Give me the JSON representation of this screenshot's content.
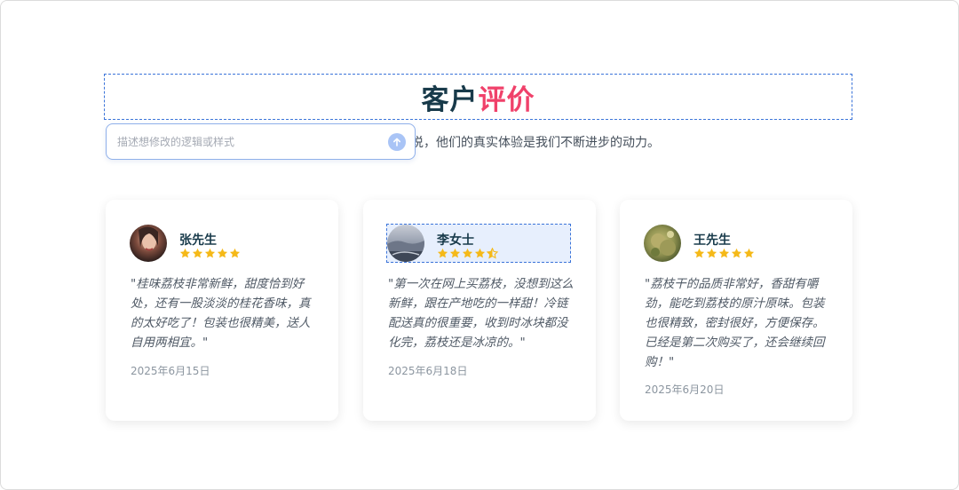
{
  "section": {
    "title_part1": "客户",
    "title_part2": "评价",
    "subtitle_left": "",
    "subtitle_right": "说，他们的真实体验是我们不断进步的动力。"
  },
  "ai_input": {
    "placeholder": "描述想修改的逻辑或样式"
  },
  "colors": {
    "accent": "#f0416a",
    "heading": "#183a4a",
    "star": "#f5b918",
    "selection": "#3b74d9"
  },
  "reviews": [
    {
      "name": "张先生",
      "rating": 5,
      "text": "\"桂味荔枝非常新鲜，甜度恰到好处，还有一股淡淡的桂花香味，真的太好吃了！包装也很精美，送人自用两相宜。\"",
      "date": "2025年6月15日"
    },
    {
      "name": "李女士",
      "rating": 4.5,
      "text": "\"第一次在网上买荔枝，没想到这么新鲜，跟在产地吃的一样甜！冷链配送真的很重要，收到时冰块都没化完，荔枝还是冰凉的。\"",
      "date": "2025年6月18日"
    },
    {
      "name": "王先生",
      "rating": 5,
      "text": "\"荔枝干的品质非常好，香甜有嚼劲，能吃到荔枝的原汁原味。包装也很精致，密封很好，方便保存。已经是第二次购买了，还会继续回购！\"",
      "date": "2025年6月20日"
    }
  ]
}
